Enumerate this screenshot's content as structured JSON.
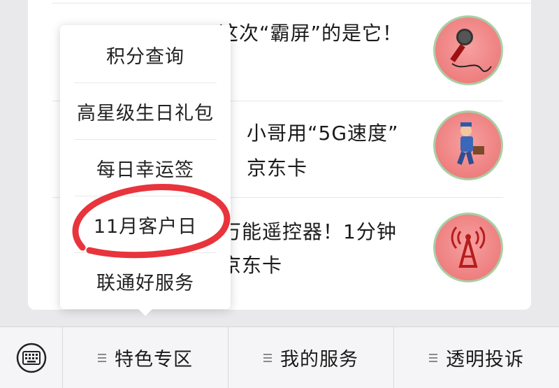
{
  "articles": [
    {
      "title": "这次“霸屏”的是它！",
      "icon": "microphone-icon"
    },
    {
      "title": "小哥用“5G速度”\n京东卡",
      "icon": "delivery-man-icon"
    },
    {
      "title": "万能遥控器！1分钟\n京东卡",
      "icon": "signal-tower-icon"
    }
  ],
  "popup_menu": {
    "items": [
      "积分查询",
      "高星级生日礼包",
      "每日幸运签",
      "11月客户日",
      "联通好服务"
    ],
    "circled_item": "11月客户日"
  },
  "bottom_menu": {
    "keyboard_icon": "keyboard-icon",
    "items": [
      "特色专区",
      "我的服务",
      "透明投诉"
    ]
  },
  "colors": {
    "background": "#e9e9ec",
    "thumb_fill": "#ee7f7f",
    "thumb_ring": "#a9cfa5",
    "annotation_red": "#e8343c"
  }
}
